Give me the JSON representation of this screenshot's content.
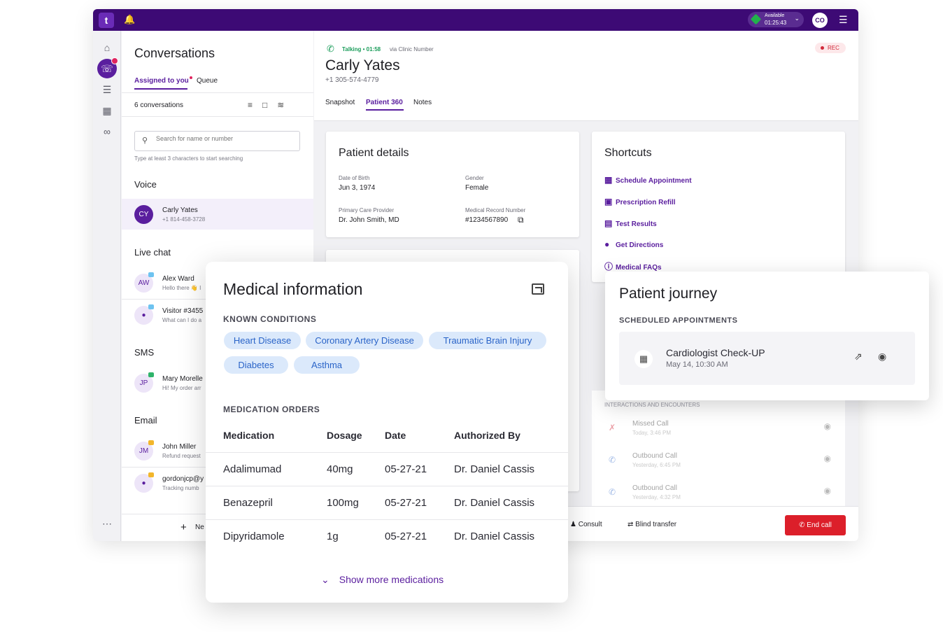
{
  "topbar": {
    "logo": "t",
    "status_label": "Available",
    "status_time": "01:25:43",
    "user_initials": "CO"
  },
  "conversations": {
    "title": "Conversations",
    "tabs": [
      "Assigned to you",
      "Queue"
    ],
    "count_label": "6 conversations",
    "search_placeholder": "Search for name or number",
    "search_hint": "Type at least 3 characters to start searching",
    "sections": {
      "voice": "Voice",
      "live_chat": "Live chat",
      "sms": "SMS",
      "email": "Email"
    },
    "voice_items": [
      {
        "initials": "CY",
        "name": "Carly Yates",
        "sub": "+1 814-458-3728"
      }
    ],
    "chat_items": [
      {
        "initials": "AW",
        "name": "Alex Ward",
        "sub": "Hello there 👋 I"
      },
      {
        "initials": "",
        "name": "Visitor #3455",
        "sub": "What can I do a"
      }
    ],
    "sms_items": [
      {
        "initials": "JP",
        "name": "Mary Morelle",
        "sub": "Hi! My order arr"
      }
    ],
    "email_items": [
      {
        "initials": "JM",
        "name": "John Miller",
        "sub": "Refund request"
      },
      {
        "initials": "",
        "name": "gordonjcp@y",
        "sub": "Tracking numb"
      }
    ],
    "new_label": "Ne"
  },
  "call": {
    "status": "Talking • 01:58",
    "via": "via Clinic Number",
    "name": "Carly Yates",
    "number": "+1 305-574-4779",
    "rec": "REC",
    "tabs": [
      "Snapshot",
      "Patient 360",
      "Notes"
    ]
  },
  "patient_details": {
    "title": "Patient details",
    "fields": [
      {
        "label": "Date of Birth",
        "value": "Jun 3, 1974"
      },
      {
        "label": "Gender",
        "value": "Female"
      },
      {
        "label": "Primary Care Provider",
        "value": "Dr. John Smith, MD"
      },
      {
        "label": "Medical Record Number",
        "value": "#1234567890"
      }
    ]
  },
  "shortcuts": {
    "title": "Shortcuts",
    "items": [
      {
        "icon": "calendar-icon",
        "label": "Schedule Appointment"
      },
      {
        "icon": "pill-icon",
        "label": "Prescription Refill"
      },
      {
        "icon": "clipboard-icon",
        "label": "Test Results"
      },
      {
        "icon": "location-icon",
        "label": "Get Directions"
      },
      {
        "icon": "info-icon",
        "label": "Medical FAQs"
      }
    ]
  },
  "interactions": {
    "title": "INTERACTIONS AND ENCOUNTERS",
    "items": [
      {
        "icon": "missed-call-icon",
        "title": "Missed Call",
        "sub": "Today, 3:46 PM"
      },
      {
        "icon": "outbound-call-icon",
        "title": "Outbound Call",
        "sub": "Yesterday, 6:45 PM"
      },
      {
        "icon": "outbound-call-icon",
        "title": "Outbound Call",
        "sub": "Yesterday, 4:32 PM"
      }
    ]
  },
  "bottom_bar": {
    "consult": "Consult",
    "blind_transfer": "Blind transfer",
    "end_call": "End call"
  },
  "medical": {
    "title": "Medical information",
    "conditions_label": "KNOWN CONDITIONS",
    "conditions": [
      "Heart Disease",
      "Coronary Artery Disease",
      "Traumatic Brain Injury",
      "Diabetes",
      "Asthma"
    ],
    "orders_label": "MEDICATION ORDERS",
    "columns": [
      "Medication",
      "Dosage",
      "Date",
      "Authorized By"
    ],
    "rows": [
      [
        "Adalimumad",
        "40mg",
        "05-27-21",
        "Dr. Daniel Cassis"
      ],
      [
        "Benazepril",
        "100mg",
        "05-27-21",
        "Dr. Daniel Cassis"
      ],
      [
        "Dipyridamole",
        "1g",
        "05-27-21",
        "Dr. Daniel Cassis"
      ]
    ],
    "show_more": "Show more medications"
  },
  "journey": {
    "title": "Patient journey",
    "scheduled_label": "SCHEDULED APPOINTMENTS",
    "appointment": {
      "title": "Cardiologist Check-UP",
      "sub": "May 14, 10:30 AM"
    }
  },
  "colors": {
    "brand": "#3d0a75",
    "accent": "#5a1e9e",
    "end_call": "#dc1f2a",
    "talking": "#1a9c5a"
  }
}
